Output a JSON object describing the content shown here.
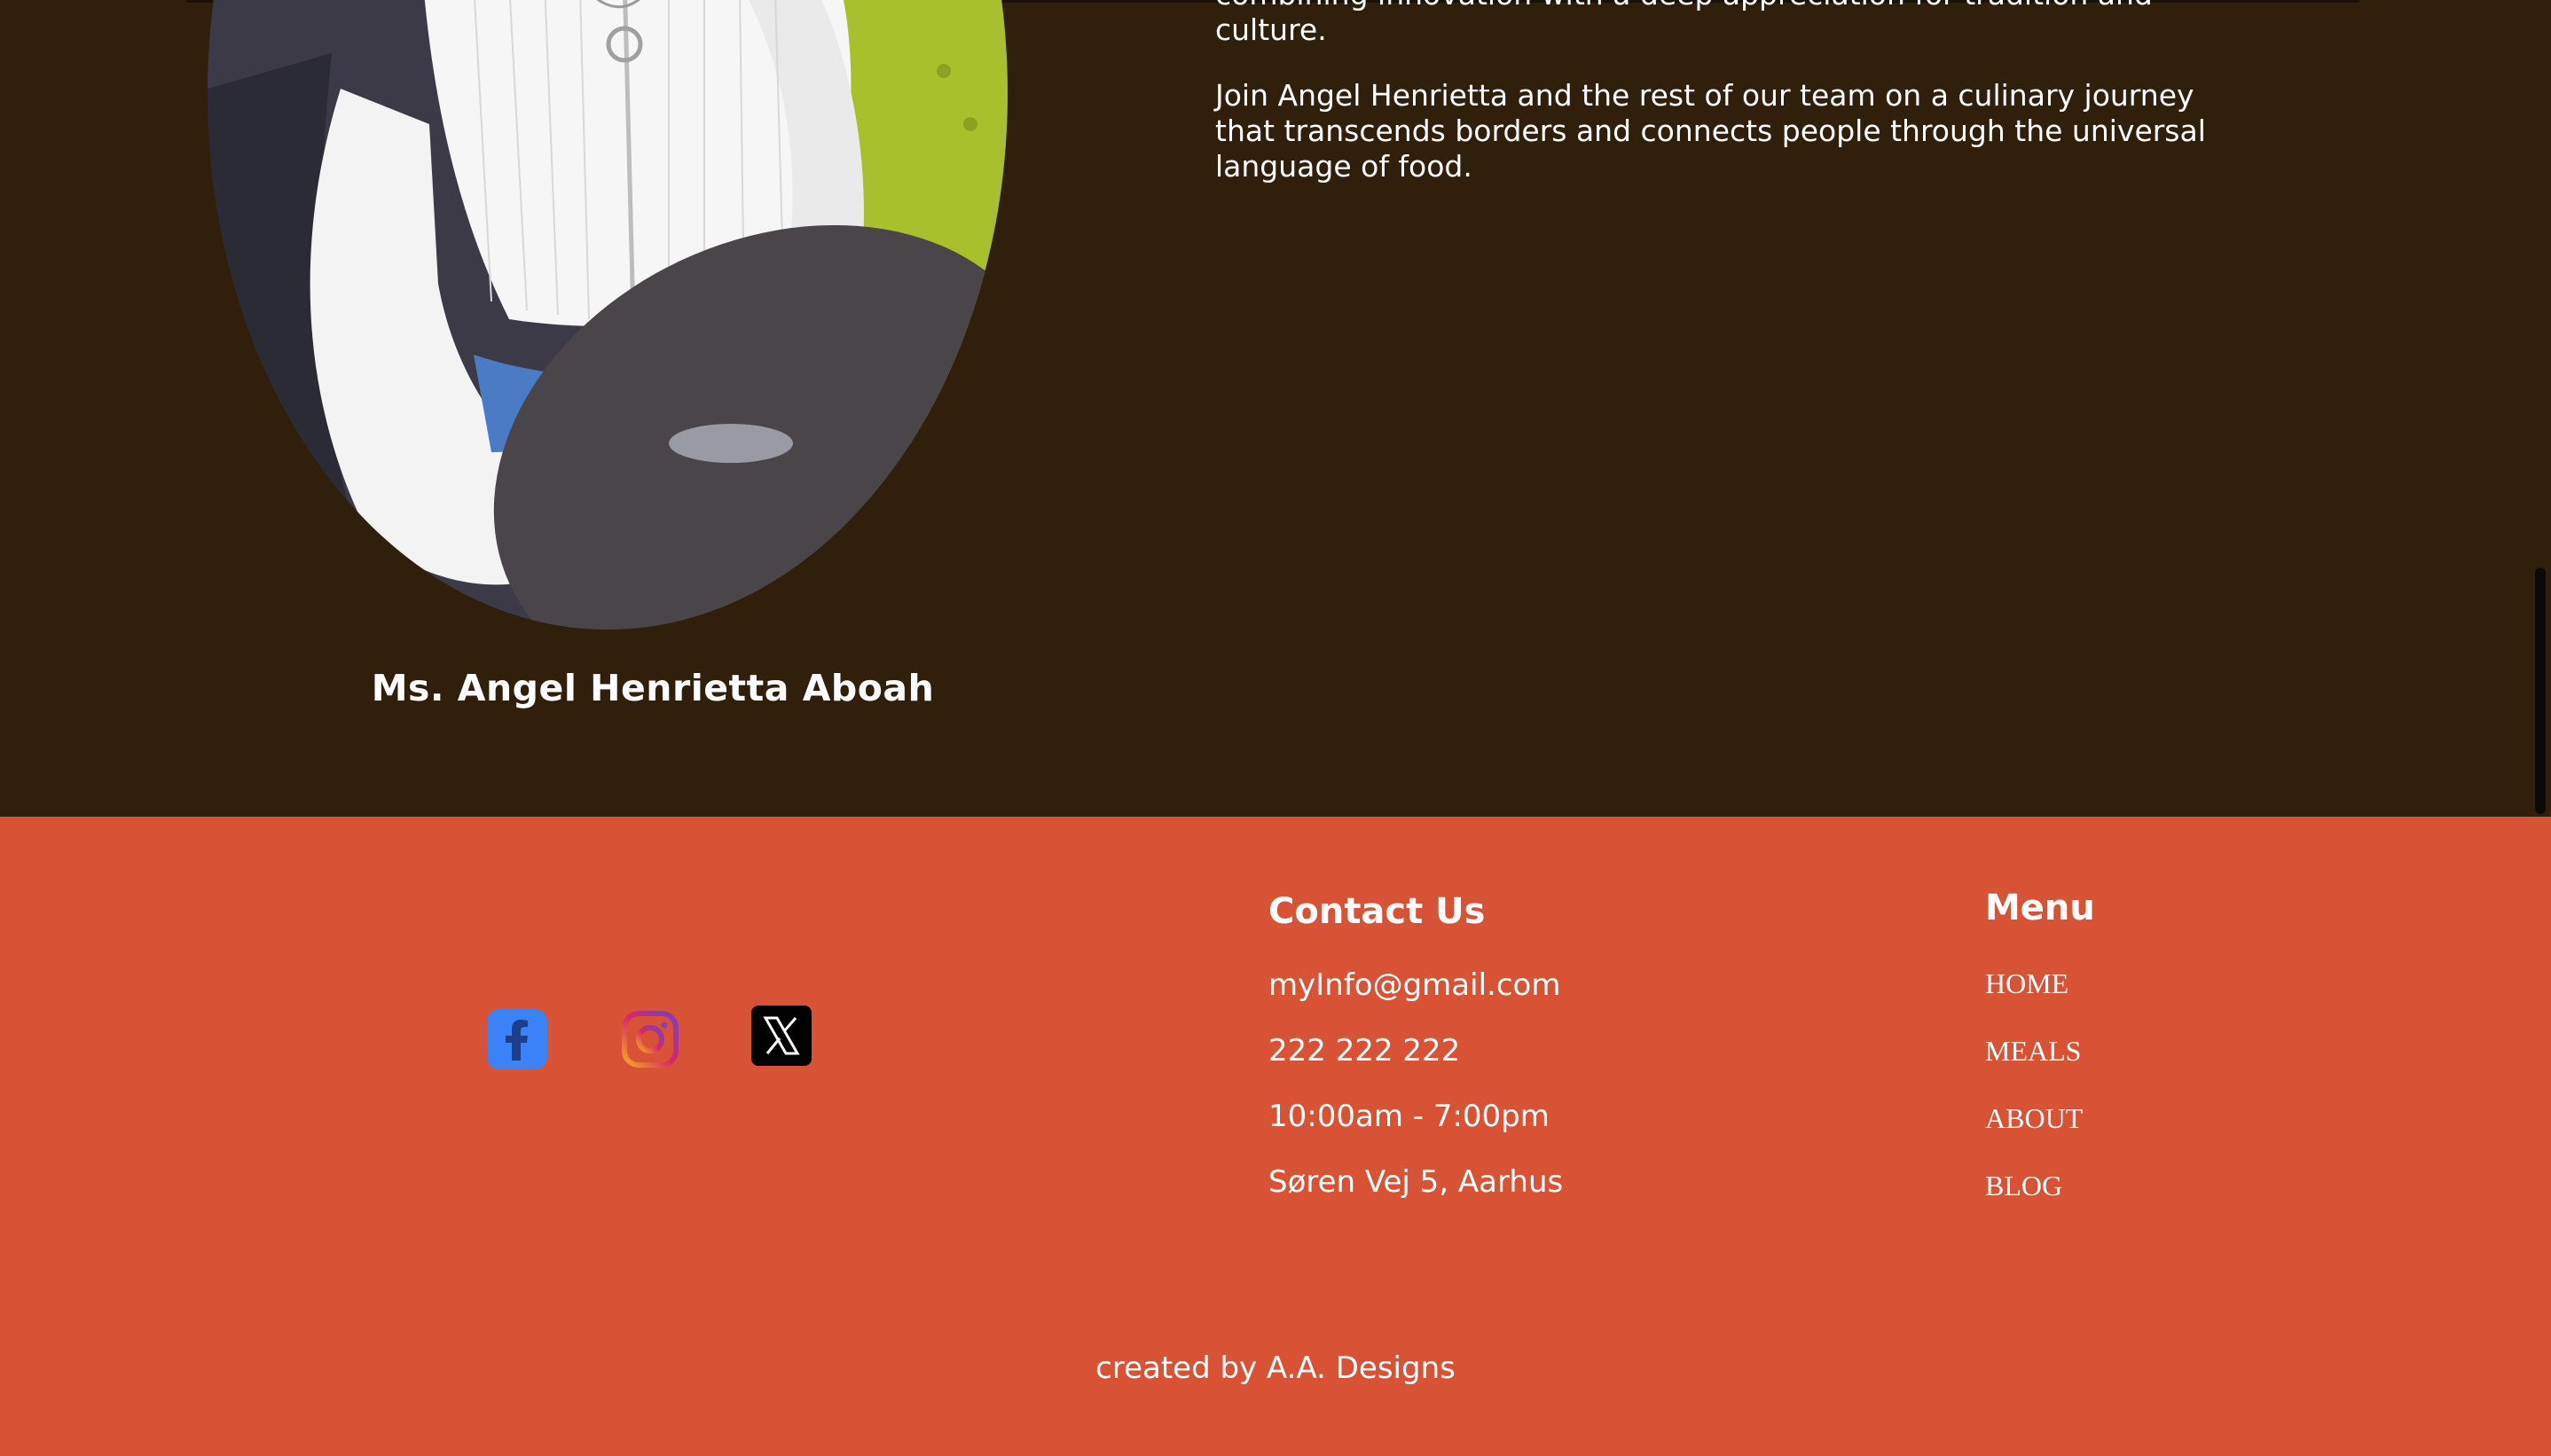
{
  "about": {
    "bio_paragraph_1": "combining innovation with a deep appreciation for tradition and culture.",
    "bio_paragraph_2": "Join Angel Henrietta and the rest of our team on a culinary journey that transcends borders and connects people through the universal language of food.",
    "person_name": "Ms. Angel Henrietta Aboah"
  },
  "footer": {
    "social": [
      {
        "icon": "facebook-icon",
        "color": "#3b82f6"
      },
      {
        "icon": "instagram-icon",
        "color": "#c13584"
      },
      {
        "icon": "x-icon",
        "color": "#000000"
      }
    ],
    "contact": {
      "title": "Contact Us",
      "email": "myInfo@gmail.com",
      "phone": "222 222 222",
      "hours": "10:00am - 7:00pm",
      "address": "Søren Vej 5, Aarhus"
    },
    "menu": {
      "title": "Menu",
      "items": [
        "HOME",
        "MEALS",
        "ABOUT",
        "BLOG"
      ]
    },
    "credit": "created by A.A. Designs"
  },
  "colors": {
    "about_background": "#301f0a",
    "footer_background": "#d85235",
    "text": "#ffffff"
  }
}
